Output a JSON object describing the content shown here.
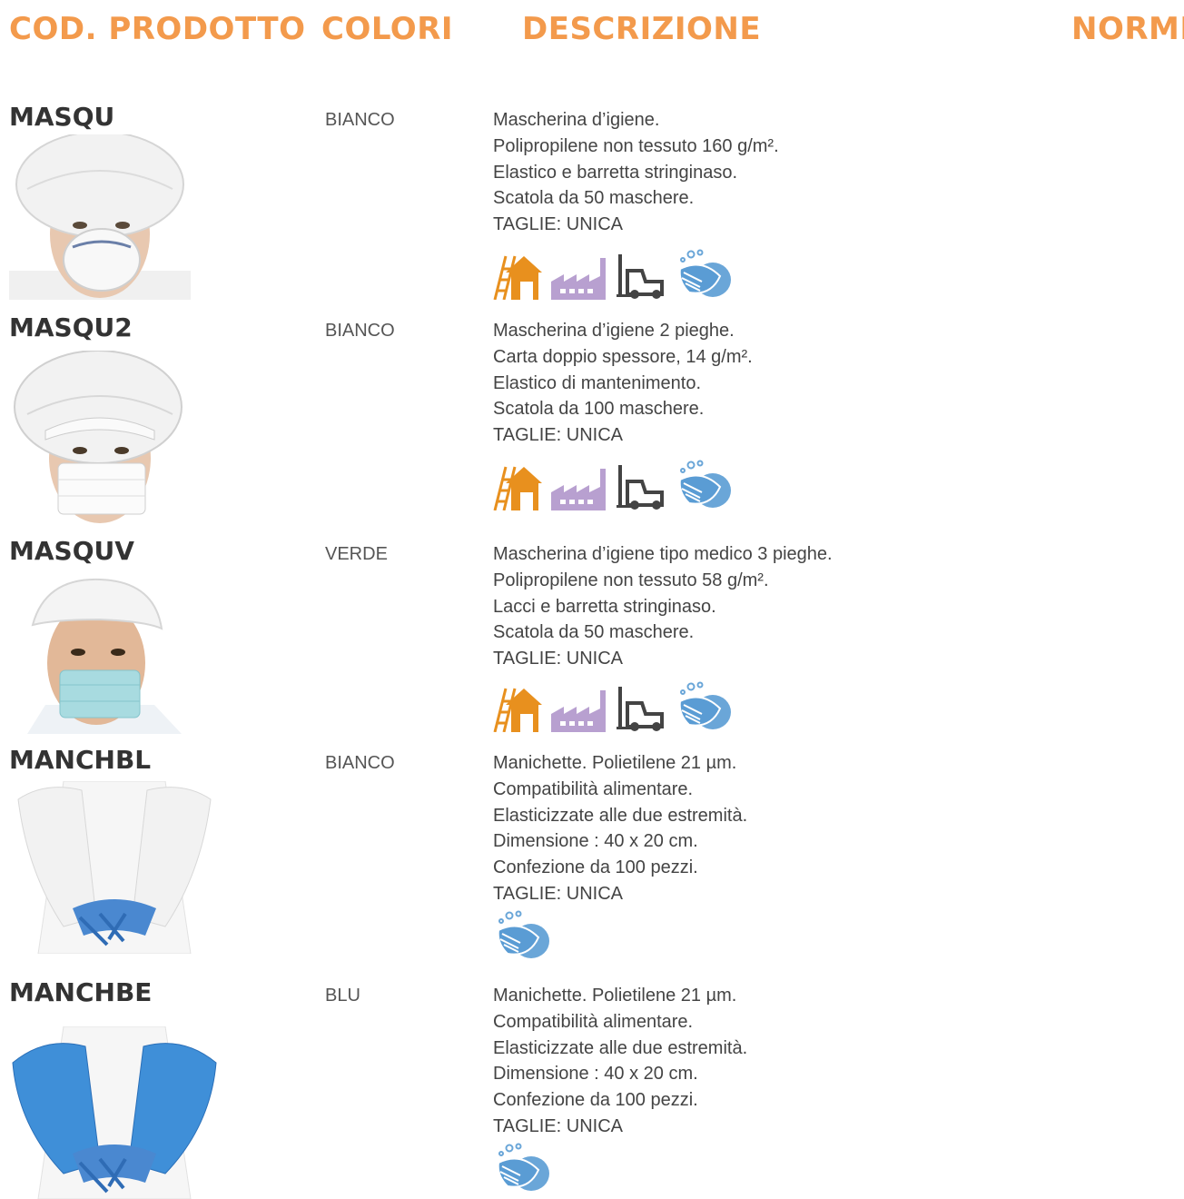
{
  "headers": {
    "code": "COD. PRODOTTO",
    "colors": "COLORI",
    "description": "DESCRIZIONE",
    "norms": "NORME"
  },
  "accent_color": "#f39a4c",
  "products": [
    {
      "code": "MASQU",
      "color": "BIANCO",
      "photo": "woman-white-dust-mask-hairnet",
      "description": [
        "Mascherina d’igiene.",
        "Polipropilene non tessuto 160 g/m².",
        "Elastico e barretta stringinaso.",
        "Scatola da 50 maschere.",
        "TAGLIE: UNICA"
      ],
      "icons": [
        "construction-icon",
        "factory-icon",
        "forklift-icon",
        "hygiene-hands-icon"
      ]
    },
    {
      "code": "MASQU2",
      "color": "BIANCO",
      "photo": "woman-white-paper-mask-hairnet",
      "description": [
        "Mascherina d’igiene 2 pieghe.",
        "Carta doppio spessore, 14 g/m².",
        "Elastico di mantenimento.",
        "Scatola da 100 maschere.",
        "TAGLIE: UNICA"
      ],
      "icons": [
        "construction-icon",
        "factory-icon",
        "forklift-icon",
        "hygiene-hands-icon"
      ]
    },
    {
      "code": "MASQUV",
      "color": "VERDE",
      "photo": "man-green-medical-mask-cap",
      "description": [
        "Mascherina d’igiene tipo medico 3 pieghe.",
        "Polipropilene non tessuto 58 g/m².",
        "Lacci e barretta stringinaso.",
        "Scatola da 50 maschere.",
        "TAGLIE: UNICA"
      ],
      "icons": [
        "construction-icon",
        "factory-icon",
        "forklift-icon",
        "hygiene-hands-icon"
      ]
    },
    {
      "code": "MANCHBL",
      "color": "BIANCO",
      "photo": "white-sleeve-covers-blue-gloves",
      "description": [
        "Manichette. Polietilene 21 µm.",
        "Compatibilità alimentare.",
        "Elasticizzate alle due estremità.",
        "Dimensione : 40 x 20 cm.",
        "Confezione da 100 pezzi.",
        "TAGLIE: UNICA"
      ],
      "icons": [
        "hygiene-hands-icon"
      ]
    },
    {
      "code": "MANCHBE",
      "color": "BLU",
      "photo": "blue-sleeve-covers-blue-gloves",
      "description": [
        "Manichette. Polietilene 21 µm.",
        "Compatibilità alimentare.",
        "Elasticizzate alle due estremità.",
        "Dimensione : 40 x 20 cm.",
        "Confezione da 100 pezzi.",
        "TAGLIE: UNICA"
      ],
      "icons": [
        "hygiene-hands-icon"
      ]
    }
  ]
}
